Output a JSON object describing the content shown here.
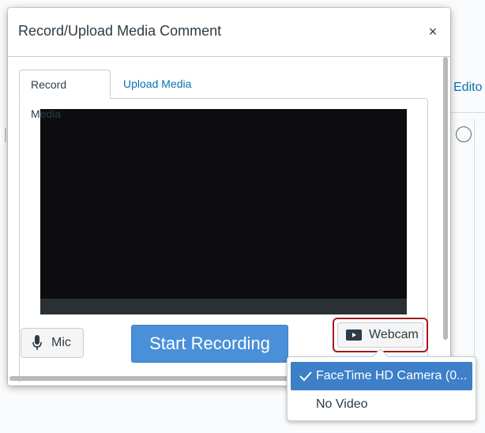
{
  "modal": {
    "title": "Record/Upload Media Comment",
    "close_label": "×"
  },
  "tabs": [
    {
      "label": "Record Media",
      "active": true
    },
    {
      "label": "Upload Media",
      "active": false
    }
  ],
  "controls": {
    "mic_label": "Mic",
    "start_label": "Start Recording",
    "webcam_label": "Webcam"
  },
  "camera_menu": {
    "items": [
      {
        "label": "FaceTime HD Camera (0...",
        "selected": true
      },
      {
        "label": "No Video",
        "selected": false
      }
    ]
  },
  "background": {
    "editor_text": "Edito"
  },
  "colors": {
    "accent": "#4a90d9",
    "link": "#0374b5",
    "highlight_border": "#a3191e",
    "selected_item": "#3d7fc8"
  }
}
